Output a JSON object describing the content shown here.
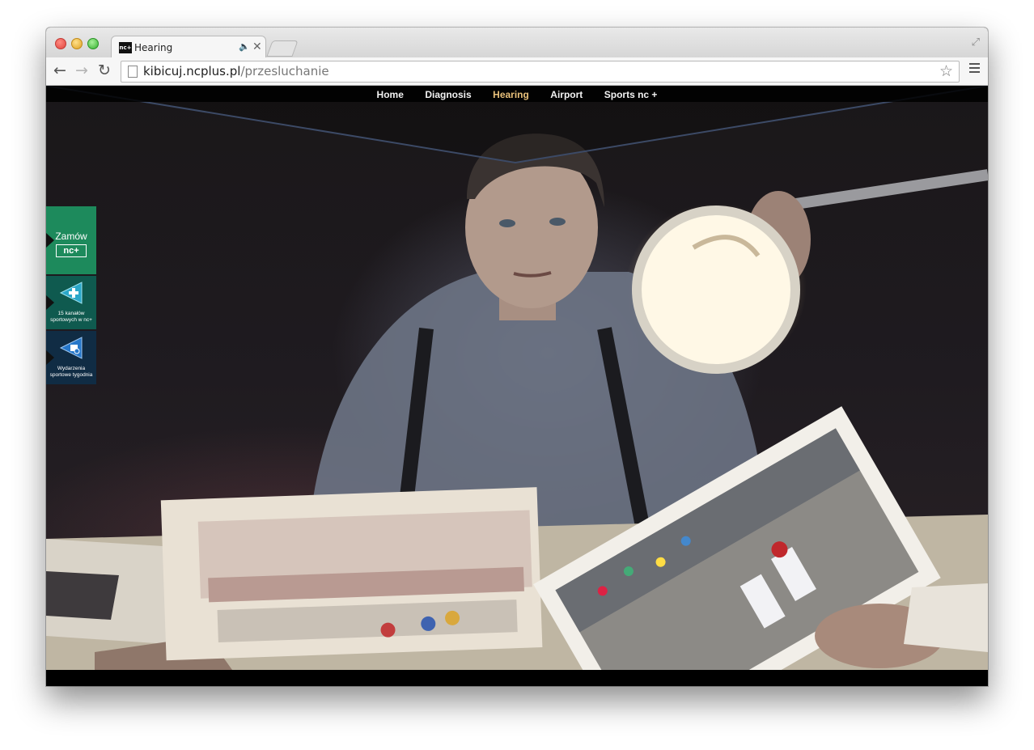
{
  "browser": {
    "tab": {
      "title": "Hearing",
      "favicon_text": "nc+",
      "audio_icon": "speaker-icon",
      "close_glyph": "✕"
    },
    "toolbar": {
      "back": "←",
      "forward": "→",
      "reload": "↻",
      "url_host": "kibicuj.ncplus.pl",
      "url_path": "/przesluchanie",
      "star": "☆"
    }
  },
  "site": {
    "nav": [
      {
        "label": "Home",
        "active": false
      },
      {
        "label": "Diagnosis",
        "active": false
      },
      {
        "label": "Hearing",
        "active": true
      },
      {
        "label": "Airport",
        "active": false
      },
      {
        "label": "Sports nc +",
        "active": false
      }
    ],
    "promos": [
      {
        "label": "Zamów",
        "logo": "nc+",
        "color": "#1d8a5c"
      },
      {
        "label": "15 kanałów sportowych w nc+",
        "icon": "add-channels-icon",
        "color": "#0f5a4f"
      },
      {
        "label": "Wydarzenia sportowe tygodnia",
        "icon": "sport-events-icon",
        "color": "#102c44"
      }
    ]
  },
  "colors": {
    "nav_active": "#e8c07a",
    "nav_text": "#f2f2f2"
  }
}
